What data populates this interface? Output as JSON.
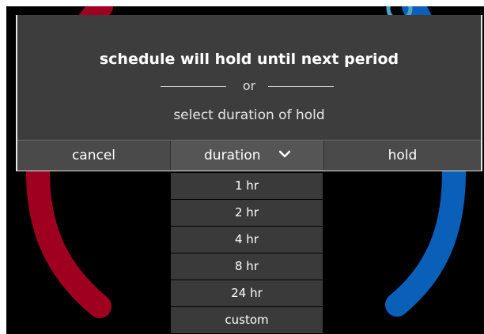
{
  "dialog": {
    "title": "schedule will hold until next period",
    "divider_text": "or",
    "subtitle": "select duration of hold"
  },
  "buttons": {
    "cancel_label": "cancel",
    "duration_label": "duration",
    "hold_label": "hold"
  },
  "dropdown": {
    "options": [
      "1 hr",
      "2 hr",
      "4 hr",
      "8 hr",
      "24 hr",
      "custom"
    ]
  },
  "colors": {
    "heat": "#a00020",
    "cool": "#0a5fb8",
    "accent": "#4fa3c8",
    "dialog_bg": "#3d3d3d"
  },
  "icons": {
    "duration_toggle": "chevron-down-icon",
    "dial_marker": "ring-icon"
  }
}
